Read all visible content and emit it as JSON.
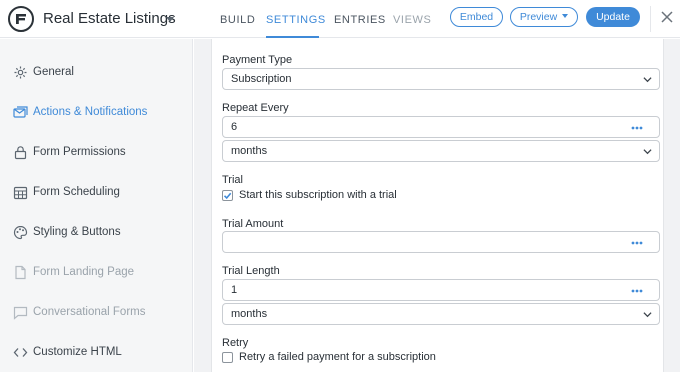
{
  "header": {
    "form_title": "Real Estate Listings",
    "tabs": [
      {
        "label": "BUILD"
      },
      {
        "label": "SETTINGS"
      },
      {
        "label": "ENTRIES"
      },
      {
        "label": "VIEWS"
      }
    ],
    "embed_label": "Embed",
    "preview_label": "Preview",
    "update_label": "Update",
    "accent_color": "#3f8ad8"
  },
  "sidebar": {
    "items": [
      {
        "label": "General",
        "icon": "gear-icon"
      },
      {
        "label": "Actions & Notifications",
        "icon": "notifications-icon"
      },
      {
        "label": "Form Permissions",
        "icon": "lock-icon"
      },
      {
        "label": "Form Scheduling",
        "icon": "calendar-icon"
      },
      {
        "label": "Styling & Buttons",
        "icon": "palette-icon"
      },
      {
        "label": "Form Landing Page",
        "icon": "page-icon"
      },
      {
        "label": "Conversational Forms",
        "icon": "chat-icon"
      },
      {
        "label": "Customize HTML",
        "icon": "code-icon"
      }
    ]
  },
  "form": {
    "payment_type": {
      "label": "Payment Type",
      "value": "Subscription"
    },
    "repeat_every": {
      "label": "Repeat Every",
      "value": "6",
      "unit": "months"
    },
    "trial": {
      "label": "Trial",
      "checkbox_label": "Start this subscription with a trial",
      "checked": true
    },
    "trial_amount": {
      "label": "Trial Amount",
      "value": ""
    },
    "trial_length": {
      "label": "Trial Length",
      "value": "1",
      "unit": "months"
    },
    "retry": {
      "label": "Retry",
      "checkbox_label": "Retry a failed payment for a subscription",
      "checked": false
    }
  }
}
